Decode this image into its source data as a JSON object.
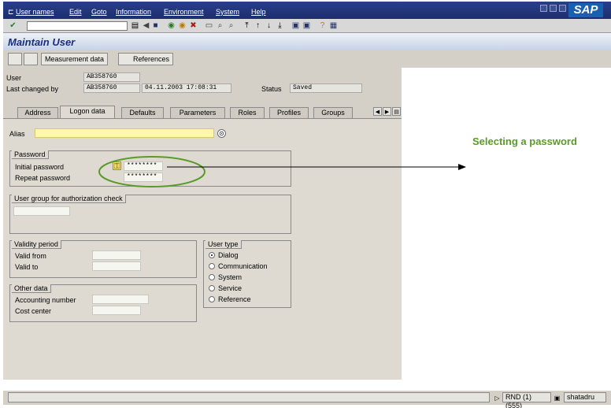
{
  "menubar": {
    "items": [
      "User names",
      "Edit",
      "Goto",
      "Information",
      "Environment",
      "System",
      "Help"
    ],
    "logo": "SAP"
  },
  "title": "Maintain User",
  "appbar": {
    "measurement_label": "Measurement data",
    "references_label": "References"
  },
  "header": {
    "user_label": "User",
    "user_value": "AB358760",
    "changed_label": "Last changed by",
    "changed_by": "AB358760",
    "changed_date": "04.11.2003 17:08:31",
    "status_label": "Status",
    "status_value": "Saved"
  },
  "tabs": [
    "Address",
    "Logon data",
    "Defaults",
    "Parameters",
    "Roles",
    "Profiles",
    "Groups"
  ],
  "alias_label": "Alias",
  "password": {
    "group": "Password",
    "initial_label": "Initial password",
    "repeat_label": "Repeat password",
    "initial_value": "********",
    "repeat_value": "********"
  },
  "usergroup": {
    "group": "User group for authorization check"
  },
  "validity": {
    "group": "Validity period",
    "from_label": "Valid from",
    "to_label": "Valid to"
  },
  "usertype": {
    "group": "User type",
    "options": [
      "Dialog",
      "Communication",
      "System",
      "Service",
      "Reference"
    ],
    "selected": "Dialog"
  },
  "other": {
    "group": "Other data",
    "acct_label": "Accounting number",
    "cost_label": "Cost center"
  },
  "statusbar": {
    "system": "RND (1) (555)",
    "host": "shatadru"
  },
  "annotation": "Selecting a password",
  "colors": {
    "menubar": "#1c2e6e",
    "annotation": "#5a9a28",
    "alias_field": "#fff6b0"
  }
}
